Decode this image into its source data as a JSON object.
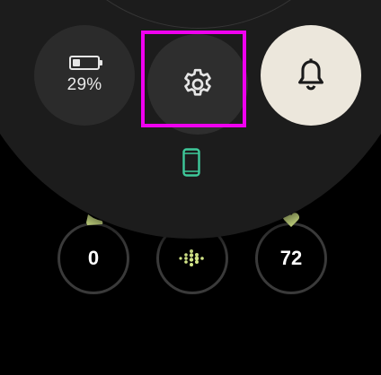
{
  "quick_settings": {
    "battery": {
      "percent_label": "29%",
      "level": 0.29,
      "icon": "battery-icon"
    },
    "settings": {
      "icon": "gear-icon"
    },
    "notifications": {
      "icon": "bell-icon"
    },
    "phone_status": {
      "icon": "phone-icon",
      "color": "#3ec99a"
    }
  },
  "watch_face": {
    "steps": {
      "value": "0",
      "icon": "shoe-icon",
      "color": "#d5e88a"
    },
    "fitbit": {
      "icon": "fitbit-logo-icon",
      "color": "#d5e88a"
    },
    "heart_rate": {
      "value": "72",
      "icon": "heart-icon",
      "color": "#d5e88a"
    }
  },
  "colors": {
    "highlight": "#f000f0",
    "bell_tile": "#ece7dc",
    "accent_green": "#3ec99a",
    "accent_lime": "#d5e88a"
  }
}
